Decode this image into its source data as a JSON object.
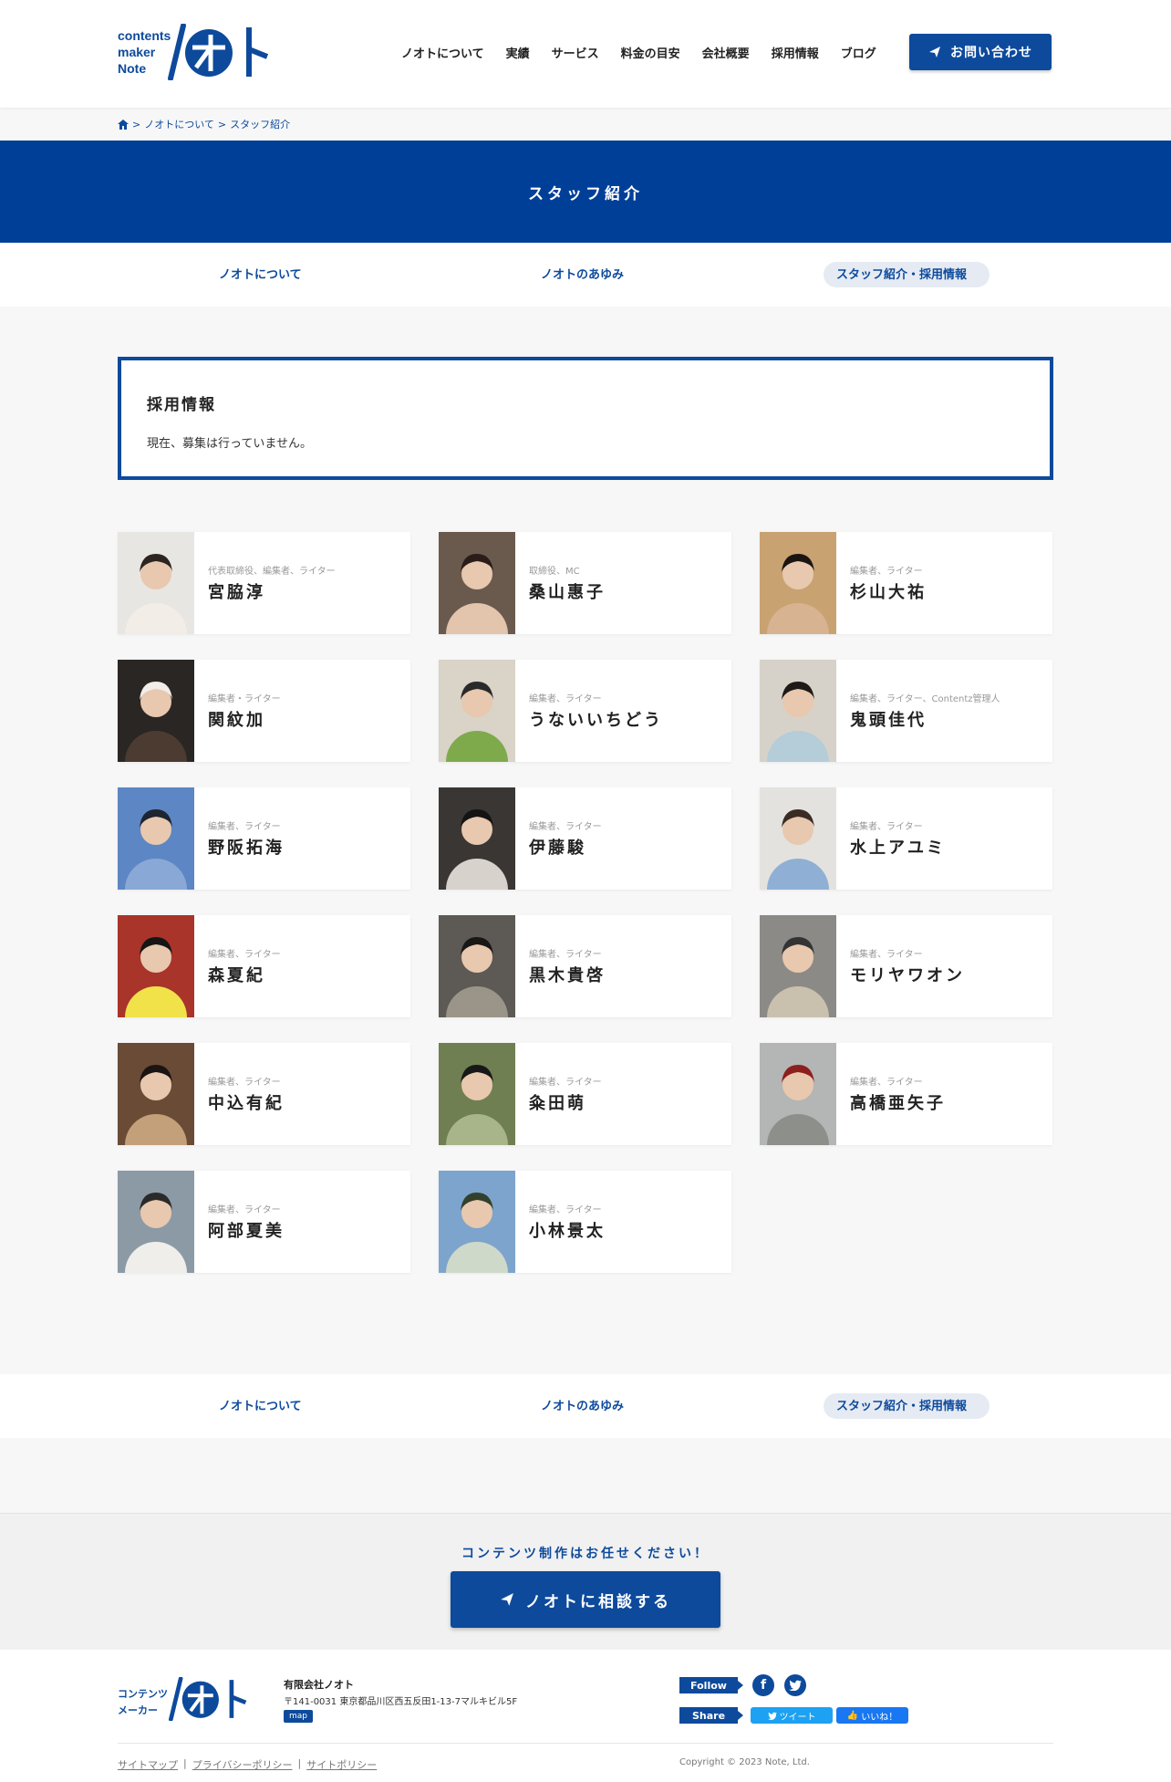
{
  "header": {
    "logo_text": [
      "contents",
      "maker",
      "Note"
    ],
    "nav": [
      "ノオトについて",
      "実績",
      "サービス",
      "料金の目安",
      "会社概要",
      "採用情報",
      "ブログ"
    ],
    "contact_label": "お問い合わせ"
  },
  "breadcrumb": [
    "ノオトについて",
    "スタッフ紹介"
  ],
  "banner": {
    "title": "スタッフ紹介"
  },
  "subnav": {
    "items": [
      "ノオトについて",
      "ノオトのあゆみ",
      "スタッフ紹介・採用情報"
    ],
    "active": "スタッフ紹介・採用情報"
  },
  "recruit": {
    "title": "採用情報",
    "body": "現在、募集は行っていません。"
  },
  "staff": [
    {
      "role": "代表取締役、編集者、ライター",
      "name": "宮脇淳",
      "photo": "person-portrait"
    },
    {
      "role": "取締役、MC",
      "name": "桑山惠子",
      "photo": "person-portrait"
    },
    {
      "role": "編集者、ライター",
      "name": "杉山大祐",
      "photo": "person-portrait"
    },
    {
      "role": "編集者・ライター",
      "name": "関紋加",
      "photo": "person-portrait"
    },
    {
      "role": "編集者、ライター",
      "name": "うないいちどう",
      "photo": "person-portrait"
    },
    {
      "role": "編集者、ライター、Contentz管理人",
      "name": "鬼頭佳代",
      "photo": "person-portrait"
    },
    {
      "role": "編集者、ライター",
      "name": "野阪拓海",
      "photo": "person-portrait"
    },
    {
      "role": "編集者、ライター",
      "name": "伊藤駿",
      "photo": "person-portrait"
    },
    {
      "role": "編集者、ライター",
      "name": "水上アユミ",
      "photo": "person-portrait"
    },
    {
      "role": "編集者、ライター",
      "name": "森夏紀",
      "photo": "person-portrait"
    },
    {
      "role": "編集者、ライター",
      "name": "黒木貴啓",
      "photo": "person-portrait"
    },
    {
      "role": "編集者、ライター",
      "name": "モリヤワオン",
      "photo": "person-portrait"
    },
    {
      "role": "編集者、ライター",
      "name": "中込有紀",
      "photo": "person-portrait"
    },
    {
      "role": "編集者、ライター",
      "name": "粂田萌",
      "photo": "person-portrait"
    },
    {
      "role": "編集者、ライター",
      "name": "高橋亜矢子",
      "photo": "person-portrait"
    },
    {
      "role": "編集者、ライター",
      "name": "阿部夏美",
      "photo": "person-portrait"
    },
    {
      "role": "編集者、ライター",
      "name": "小林景太",
      "photo": "person-portrait"
    }
  ],
  "cta": {
    "text": "コンテンツ制作はお任せください！",
    "button": "ノオトに相談する"
  },
  "footer": {
    "logo_text": [
      "コンテンツ",
      "メーカー"
    ],
    "company": "有限会社ノオト",
    "address": "〒141-0031 東京都品川区西五反田1-13-7マルキビル5F",
    "map": "map",
    "follow": "Follow",
    "share": "Share",
    "tweet": "ツイート",
    "like": "いいね！",
    "links": [
      "サイトマップ",
      "プライバシーポリシー",
      "サイトポリシー"
    ],
    "copyright": "Copyright © 2023 Note, Ltd."
  },
  "colors": {
    "brand": "#0d4a9c",
    "banner": "#003f98"
  }
}
